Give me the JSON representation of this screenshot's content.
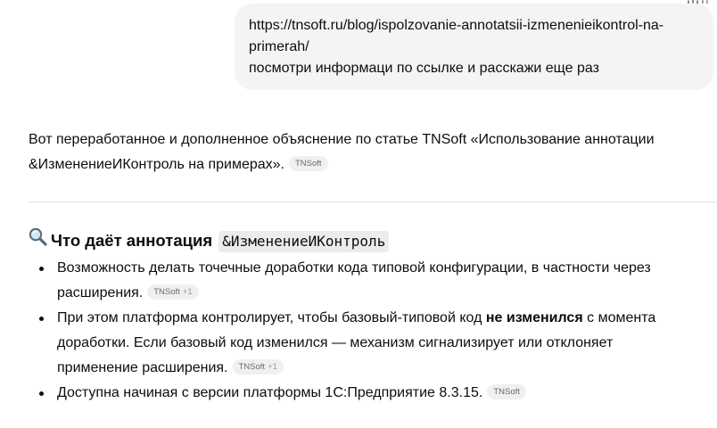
{
  "toolbar": {
    "partial_label": "Ti",
    "share_icon": "share-icon"
  },
  "user_message": {
    "lines": [
      "https://tnsoft.ru/blog/ispolzovanie-annotatsii-izmenenieikontrol-na-",
      "primerah/",
      "посмотри информаци по ссылке и расскажи еще раз"
    ]
  },
  "assistant": {
    "intro": {
      "line1": "Вот переработанное и дополненное объяснение по статье TNSoft «Использование аннотации",
      "line2": "&ИзменениеИКонтроль на примерах».",
      "source": "TNSoft"
    },
    "heading": {
      "icon": "magnifier-icon",
      "text": "Что даёт аннотация",
      "code": "&ИзменениеИКонтроль"
    },
    "bullets": [
      {
        "line1": "Возможность делать точечные доработки кода типовой конфигурации, в частности через",
        "line2": "расширения.",
        "source": "TNSoft",
        "source_extra": "+1"
      },
      {
        "line1_pre": "При этом платформа контролирует, чтобы базовый-типовой код ",
        "line1_bold": "не изменился",
        "line1_post": " с момента",
        "line2": "доработки. Если базовый код изменился — механизм сигнализирует или отклоняет",
        "line3": "применение расширения.",
        "source": "TNSoft",
        "source_extra": "+1"
      },
      {
        "line1": "Доступна начиная с версии платформы 1С:Предприятие 8.3.15.",
        "source": "TNSoft"
      }
    ]
  }
}
